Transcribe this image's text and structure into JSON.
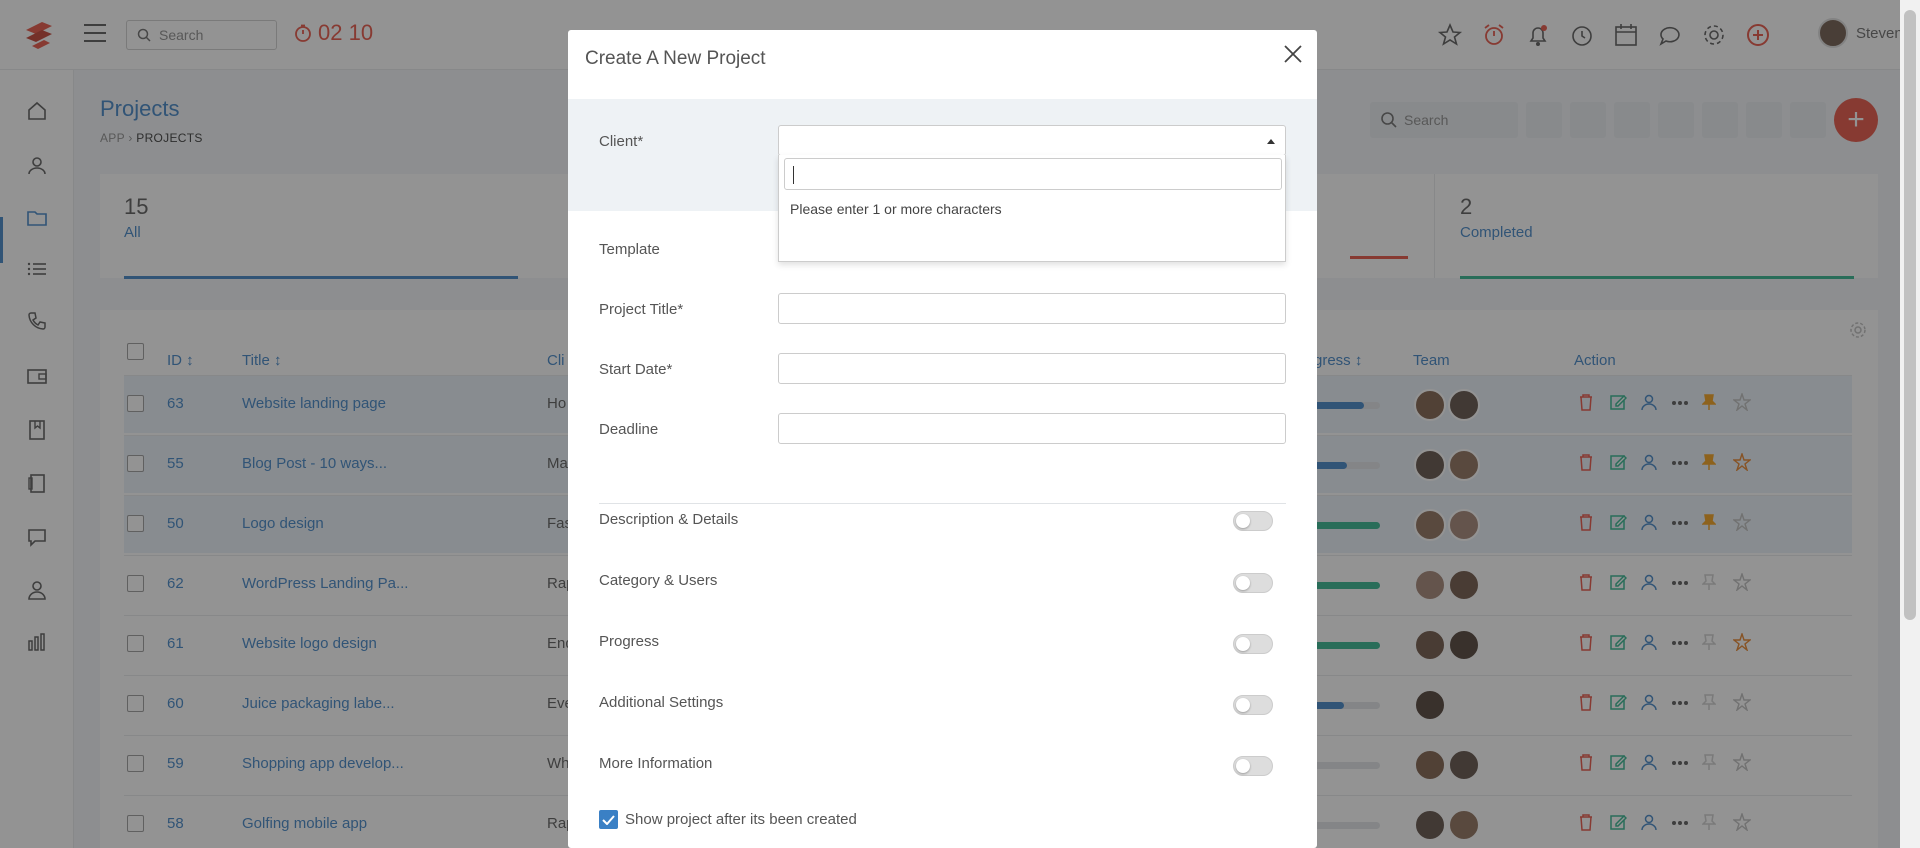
{
  "header": {
    "search_placeholder": "Search",
    "timer": "02 10",
    "user_name": "Steven",
    "icons": [
      "star-icon",
      "alarm-icon",
      "bell-icon",
      "clock-icon",
      "calendar-icon",
      "chat-icon",
      "gear-icon",
      "add-circle-icon"
    ]
  },
  "sidebar": {
    "items": [
      "home-icon",
      "clients-icon",
      "projects-icon",
      "tasks-icon",
      "leads-icon",
      "wallet-icon",
      "notes-icon",
      "files-icon",
      "tickets-icon",
      "team-icon",
      "reports-icon"
    ],
    "active": "projects-icon"
  },
  "page": {
    "title": "Projects",
    "breadcrumb_app": "APP",
    "breadcrumb_current": "PROJECTS",
    "search_placeholder": "Search"
  },
  "stats": [
    {
      "count": "15",
      "label": "All",
      "color": "#3a80c5"
    },
    {
      "count": "2",
      "label": "Completed",
      "color": "#2ab38b"
    }
  ],
  "table": {
    "headers": {
      "id": "ID ↕",
      "title": "Title ↕",
      "client": "Cli",
      "progress": "gress ↕",
      "team": "Team",
      "action": "Action"
    },
    "rows": [
      {
        "id": "63",
        "title": "Website landing page",
        "client": "Ho",
        "progress": 0.75,
        "color": "#3a80c5"
      },
      {
        "id": "55",
        "title": "Blog Post - 10 ways...",
        "client": "Ma",
        "progress": 0.5,
        "color": "#3a80c5"
      },
      {
        "id": "50",
        "title": "Logo design",
        "client": "Fas",
        "progress": 1.0,
        "color": "#2ab38b"
      },
      {
        "id": "62",
        "title": "WordPress Landing Pa...",
        "client": "Rap",
        "progress": 1.0,
        "color": "#2ab38b"
      },
      {
        "id": "61",
        "title": "Website logo design",
        "client": "End",
        "progress": 1.0,
        "color": "#2ab38b"
      },
      {
        "id": "60",
        "title": "Juice packaging labe...",
        "client": "Eve",
        "progress": 0.45,
        "color": "#3a80c5"
      },
      {
        "id": "59",
        "title": "Shopping app develop...",
        "client": "Wh",
        "progress": 0.0,
        "color": "#3a80c5"
      },
      {
        "id": "58",
        "title": "Golfing mobile app",
        "client": "Rap",
        "progress": 0.0,
        "color": "#3a80c5"
      }
    ]
  },
  "modal": {
    "title": "Create A New Project",
    "client_label": "Client*",
    "dropdown_message": "Please enter 1 or more characters",
    "template_label": "Template",
    "project_title_label": "Project Title*",
    "start_date_label": "Start Date*",
    "deadline_label": "Deadline",
    "sections": [
      "Description & Details",
      "Category & Users",
      "Progress",
      "Additional Settings",
      "More Information"
    ],
    "show_project_label": "Show project after its been created"
  }
}
